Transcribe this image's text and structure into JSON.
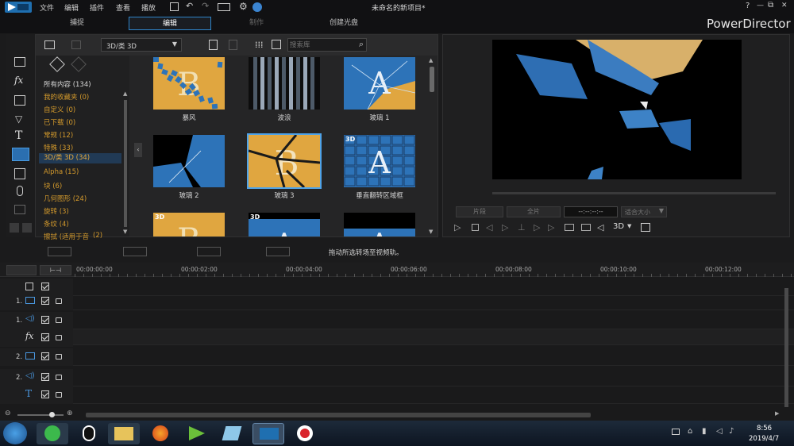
{
  "menu": {
    "file": "文件",
    "edit": "编辑",
    "plugins": "插件",
    "view": "查看",
    "playback": "播放"
  },
  "window_title": "未命名的新项目*",
  "window_controls": {
    "help": "?",
    "minimize": "—",
    "restore": "⧉",
    "close": "✕"
  },
  "modes": {
    "capture": "捕捉",
    "edit": "编辑",
    "produce": "制作",
    "create_disc": "创建光盘"
  },
  "brand": "PowerDirector",
  "library": {
    "dropdown_value": "3D/类 3D",
    "search_placeholder": "搜索库",
    "categories": [
      {
        "label": "所有内容 (134)"
      },
      {
        "label": "我的收藏夹 (0)"
      },
      {
        "label": "自定义 (0)"
      },
      {
        "label": "已下载 (0)"
      },
      {
        "label": "常规 (12)"
      },
      {
        "label": "特殊 (33)"
      },
      {
        "label": "3D/类 3D (34)"
      },
      {
        "label": "Alpha (15)"
      },
      {
        "label": "块 (6)"
      },
      {
        "label": "几何图形 (24)"
      },
      {
        "label": "旋转 (3)"
      },
      {
        "label": "条纹 (4)"
      },
      {
        "label": "擦拭 (适用于音"
      },
      {
        "label": "(2)"
      }
    ],
    "transitions": [
      {
        "label": "暴风"
      },
      {
        "label": "波浪"
      },
      {
        "label": "玻璃 1"
      },
      {
        "label": "玻璃 2"
      },
      {
        "label": "玻璃 3"
      },
      {
        "label": "垂直翻转区域框"
      }
    ],
    "badge_3d": "3D",
    "letters": {
      "b": "B",
      "a": "A"
    }
  },
  "preview": {
    "btn_clip": "片段",
    "btn_movie": "全片",
    "timecode": "--:--:--:--",
    "size": "适合大小",
    "mode_3d": "3D"
  },
  "timeline": {
    "hint": "拖动所选转场至视频轨。",
    "ruler": [
      "00:00:00:00",
      "00:00:02:00",
      "00:00:04:00",
      "00:00:06:00",
      "00:00:08:00",
      "00:00:10:00",
      "00:00:12:00"
    ],
    "tracks": [
      {
        "num": "",
        "icon": "square"
      },
      {
        "num": "1.",
        "icon": "video"
      },
      {
        "num": "1.",
        "icon": "audio"
      },
      {
        "num": "",
        "icon": "fx"
      },
      {
        "num": "2.",
        "icon": "video"
      },
      {
        "num": "2.",
        "icon": "audio"
      },
      {
        "num": "",
        "icon": "title"
      }
    ],
    "fx_text": "fx",
    "title_text": "T"
  },
  "taskbar": {
    "time": "8:56",
    "date": "2019/4/7"
  },
  "colors": {
    "accent": "#2f84c9",
    "category": "#d49a2c",
    "selected_category_bg": "#213a55"
  }
}
